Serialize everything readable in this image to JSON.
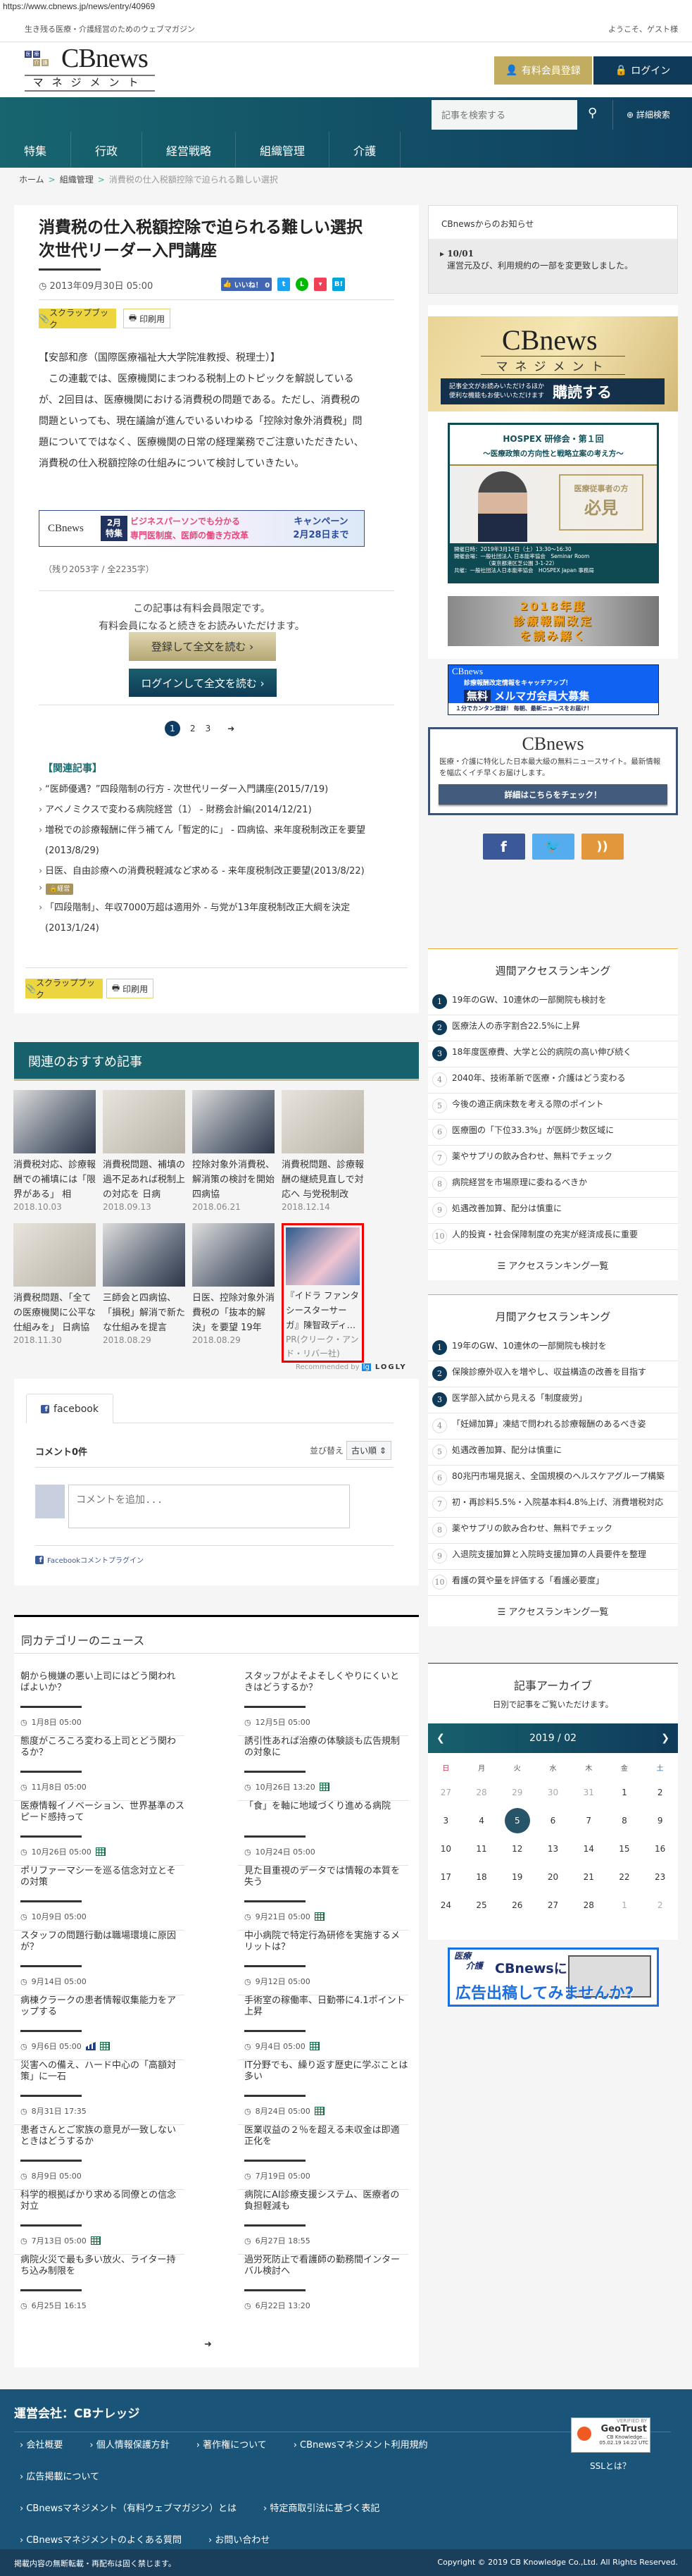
{
  "url": "https://www.cbnews.jp/news/entry/40969",
  "topbar": {
    "tagline": "生き残る医療・介護経営のためのウェブマガジン",
    "welcome": "ようこそ、ゲスト様"
  },
  "logo": {
    "badges": [
      "医",
      "療",
      "介",
      "護"
    ],
    "name": "CBnews",
    "sub": "マネジメント"
  },
  "header": {
    "register_label": "有料会員登録",
    "login_label": "ログイン"
  },
  "search": {
    "placeholder": "記事を検索する",
    "advanced_label": "詳細検索"
  },
  "nav": [
    "特集",
    "行政",
    "経営戦略",
    "組織管理",
    "介護"
  ],
  "breadcrumb": [
    "ホーム",
    "組織管理",
    "消費税の仕入税額控除で迫られる難しい選択"
  ],
  "article": {
    "title_line1": "消費税の仕入税額控除で迫られる難しい選択",
    "title_line2": "次世代リーダー入門講座",
    "date": "2013年09月30日 05:00",
    "like_label": "いいね！ 0",
    "scrapbook_label": "スクラップブック",
    "print_label": "印刷用",
    "author": "【安部和彦（国際医療福祉大大学院准教授、税理士）】",
    "body": "　この連載では、医療機関にまつわる税制上のトピックを解説しているが、2回目は、医療機関における消費税の問題である。ただし、消費税の問題といっても、現在議論が進んでいるいわゆる「控除対象外消費税」問題についてではなく、医療機関の日常の経理業務でご注意いただきたい、消費税の仕入税額控除の仕組みについて検討していきたい。",
    "banner": {
      "month": "2月",
      "feature": "特集",
      "line1": "ビジネスパーソンでも分かる",
      "line2": "専門医制度、医師の働き方改革",
      "campaign": "キャンペーン",
      "until": "2月28日まで"
    },
    "remaining": "（残り2053字 / 全2235字）",
    "paywall_line1": "この記事は有料会員限定です。",
    "paywall_line2": "有料会員になると続きをお読みいただけます。",
    "register_read": "登録して全文を読む ›",
    "login_read": "ログインして全文を読む ›",
    "pages": [
      "1",
      "2",
      "3"
    ],
    "related_heading": "【関連記事】",
    "related": [
      {
        "text": "“医師優遇？”四段階制の行方 - 次世代リーダー入門講座(2015/7/19)"
      },
      {
        "text": "アベノミクスで変わる病院経営（1） - 財務会計編(2014/12/21)"
      },
      {
        "text": "増税での診療報酬に伴う補てん「暫定的に」 - 四病協、来年度税制改正を要望(2013/8/29)"
      },
      {
        "text": "日医、自由診療への消費税軽減など求める - 来年度税制改正要望(2013/8/22)",
        "tag": "経営"
      },
      {
        "text": "「四段階制」、年収7000万超は適用外 - 与党が13年度税制改正大綱を決定(2013/1/24)"
      }
    ]
  },
  "recommended": {
    "heading": "関連のおすすめ記事",
    "items": [
      {
        "title": "消費税対応、診療報酬での補填には「限界がある」 相澤・…",
        "date": "2018.10.03"
      },
      {
        "title": "消費税問題、補填の過不足あれば税制上の対応を 日病協、…",
        "date": "2018.09.13"
      },
      {
        "title": "控除対象外消費税、解消策の検討を開始 四病協",
        "date": "2018.06.21"
      },
      {
        "title": "消費税問題、診療報酬の継続見直しで対応へ 与党税制改正…",
        "date": "2018.12.14"
      },
      {
        "title": "消費税問題、「全ての医療機関に公平な仕組みを」 日病協",
        "date": "2018.11.30"
      },
      {
        "title": "三師会と四病協、「損税」解消で新たな仕組みを提言 日…",
        "date": "2018.08.29"
      },
      {
        "title": "日医、控除対象外消費税の「抜本的解決」を要望 19年度…",
        "date": "2018.08.29"
      }
    ],
    "pr": {
      "title": "『イドラ ファンタシースターサーガ』陳智政ディ…",
      "sponsor": "PR(クリーク・アンド・リバー社)"
    },
    "recommended_by": "Recommended by",
    "logly": "LOGLY"
  },
  "comments": {
    "tab": "facebook",
    "count": "コメント0件",
    "sort_label": "並び替え",
    "sort_value": "古い順",
    "placeholder": "コメントを追加...",
    "plugin": "Facebookコメントプラグイン"
  },
  "category_news": {
    "heading": "同カテゴリーのニュース",
    "items": [
      {
        "title": "朝から機嫌の悪い上司にはどう関わればよいか？",
        "date": "1月8日 05:00",
        "icons": []
      },
      {
        "title": "スタッフがよそよそしくやりにくいときはどうするか？",
        "date": "12月5日 05:00",
        "icons": []
      },
      {
        "title": "態度がころころ変わる上司とどう関わるか？",
        "date": "11月8日 05:00",
        "icons": []
      },
      {
        "title": "誘引性あれば治療の体験談も広告規制の対象に",
        "date": "10月26日 13:20",
        "icons": [
          "table"
        ]
      },
      {
        "title": "医療情報イノベーション、世界基準のスピード感持って",
        "date": "10月26日 05:00",
        "icons": [
          "table"
        ]
      },
      {
        "title": "「食」を軸に地域づくり進める病院",
        "date": "10月24日 05:00",
        "icons": []
      },
      {
        "title": "ポリファーマシーを巡る信念対立とその対策",
        "date": "10月9日 05:00",
        "icons": []
      },
      {
        "title": "見た目重視のデータでは情報の本質を失う",
        "date": "9月21日 05:00",
        "icons": [
          "table"
        ]
      },
      {
        "title": "スタッフの問題行動は職場環境に原因が？",
        "date": "9月14日 05:00",
        "icons": []
      },
      {
        "title": "中小病院で特定行為研修を実施するメリットは？",
        "date": "9月12日 05:00",
        "icons": []
      },
      {
        "title": "病棟クラークの患者情報収集能力をアップする",
        "date": "9月6日 05:00",
        "icons": [
          "chart",
          "table"
        ]
      },
      {
        "title": "手術室の稼働率、日勤帯に4.1ポイント上昇",
        "date": "9月4日 05:00",
        "icons": [
          "table"
        ]
      },
      {
        "title": "災害への備え、ハード中心の「高額対策」に一石",
        "date": "8月31日 17:35",
        "icons": []
      },
      {
        "title": "IT分野でも、繰り返す歴史に学ぶことは多い",
        "date": "8月24日 05:00",
        "icons": [
          "table"
        ]
      },
      {
        "title": "患者さんとご家族の意見が一致しないときはどうするか",
        "date": "8月9日 05:00",
        "icons": []
      },
      {
        "title": "医業収益の２％を超える未収金は即適正化を",
        "date": "7月19日 05:00",
        "icons": []
      },
      {
        "title": "科学的根拠ばかり求める同僚との信念対立",
        "date": "7月13日 05:00",
        "icons": [
          "table"
        ]
      },
      {
        "title": "病院にAI診療支援システム、医療者の負担軽減も",
        "date": "6月27日 18:55",
        "icons": []
      },
      {
        "title": "病院火災で最も多い放火、ライター持ち込み制限を",
        "date": "6月25日 16:15",
        "icons": []
      },
      {
        "title": "過労死防止で看護師の勤務間インターバル検討へ",
        "date": "6月22日 13:20",
        "icons": []
      }
    ]
  },
  "sidebar": {
    "notice": {
      "heading": "CBnewsからのお知らせ",
      "date": "10/01",
      "text": "運営元及び、利用規約の一部を変更致しました。"
    },
    "subscribe_banner": {
      "line1": "記事全文がお読みいただけるほか",
      "line2": "便利な機能もお使いいただけます",
      "cta": "購読する"
    },
    "hospex": {
      "title": "HOSPEX 研修会・第１回",
      "subtitle": "～医療政策の方向性と戦略立案の考え方～",
      "badge1": "医療従事者の方",
      "badge2": "必見",
      "date": "開催日時：2019年3月16日（土）13:30～16:30",
      "venue": "開催会場：一般社団法人 日本能率協会　Seminar Room",
      "address": "（東京都港区芝公園 3-1-22）",
      "host": "共催：一般社団法人日本能率協会　HOSPEX Japan 事務局"
    },
    "revision_banner": {
      "line1": "2018年度",
      "line2": "診療報酬改定",
      "line3": "を読み解く"
    },
    "mailmag": {
      "brand": "CBnews",
      "line1": "診療報酬改定情報をキャッチアップ！",
      "free": "無料",
      "line2": "メルマガ会員大募集",
      "line3": "１分でカンタン登録！ 毎朝、最新ニュースをお届け！"
    },
    "cbnews_box": {
      "text": "医療・介護に特化した日本最大級の無料ニュースサイト。最新情報を幅広くイチ早くお届けします。",
      "button": "詳細はこちらをチェック！"
    },
    "social_colors": {
      "facebook": "#3b5998",
      "twitter": "#55acee",
      "rss": "#e2983a"
    },
    "weekly": {
      "heading": "週間アクセスランキング",
      "items": [
        "19年のGW、10連休の一部開院も検討を",
        "医療法人の赤字割合22.5%に上昇",
        "18年度医療費、大学と公的病院の高い伸び続く",
        "2040年、技術革新で医療・介護はどう変わる",
        "今後の適正病床数を考える際のポイント",
        "医療圏の「下位33.3%」が医師少数区域に",
        "薬やサプリの飲み合わせ、無料でチェック",
        "病院経営を市場原理に委ねるべきか",
        "処遇改善加算、配分は慎重に",
        "人的投資・社会保障制度の充実が経済成長に重要"
      ],
      "more": "アクセスランキング一覧"
    },
    "monthly": {
      "heading": "月間アクセスランキング",
      "items": [
        "19年のGW、10連休の一部開院も検討を",
        "保険診療外収入を増やし、収益構造の改善を目指す",
        "医学部入試から見える「制度疲労」",
        "「妊婦加算」凍結で問われる診療報酬のあるべき姿",
        "処遇改善加算、配分は慎重に",
        "80兆円市場見据え、全国規模のヘルスケアグループ構築",
        "初・再診料5.5%・入院基本料4.8%上げ、消費増税対応",
        "薬やサプリの飲み合わせ、無料でチェック",
        "入退院支援加算と入院時支援加算の人員要件を整理",
        "看護の質や量を評価する「看護必要度」"
      ],
      "more": "アクセスランキング一覧"
    },
    "archive": {
      "heading": "記事アーカイブ",
      "subtitle": "日別で記事をご覧いただけます。",
      "month": "2019 / 02",
      "weekdays": [
        "日",
        "月",
        "火",
        "水",
        "木",
        "金",
        "土"
      ],
      "days": [
        "27",
        "28",
        "29",
        "30",
        "31",
        "1",
        "2",
        "3",
        "4",
        "5",
        "6",
        "7",
        "8",
        "9",
        "10",
        "11",
        "12",
        "13",
        "14",
        "15",
        "16",
        "17",
        "18",
        "19",
        "20",
        "21",
        "22",
        "23",
        "24",
        "25",
        "26",
        "27",
        "28",
        "1",
        "2"
      ],
      "outside_days": [
        0,
        1,
        2,
        3,
        4,
        33,
        34
      ],
      "selected": "5"
    },
    "ad_banner": {
      "line1": "医療",
      "line2": "介護",
      "line3": "CBnewsに",
      "line4": "広告出稿してみませんか?"
    }
  },
  "footer": {
    "company": "運営会社：CBナレッジ",
    "links": [
      "会社概要",
      "個人情報保護方針",
      "著作権について",
      "CBnewsマネジメント利用規約",
      "広告掲載について",
      "CBnewsマネジメント（有料ウェブマガジン）とは",
      "特定商取引法に基づく表記",
      "CBnewsマネジメントのよくある質問",
      "お問い合わせ"
    ],
    "geotrust": {
      "verified": "VERIFIED BY",
      "brand": "GeoTrust",
      "org": "CB Knowledge...",
      "stamp": "05.02.19 14:22 UTC"
    },
    "ssl": "SSLとは？",
    "notice": "掲載内容の無断転載・再配布は固く禁じます。",
    "copyright": "Copyright © 2019 CB Knowledge Co.,Ltd. All Rights Reserved."
  },
  "colors": {
    "nav_teal": "#17656f",
    "navy": "#0f3a5a",
    "gold": "#c2ac5f",
    "scrap_yellow": "#ecd53e",
    "footer": "#1b5479"
  }
}
